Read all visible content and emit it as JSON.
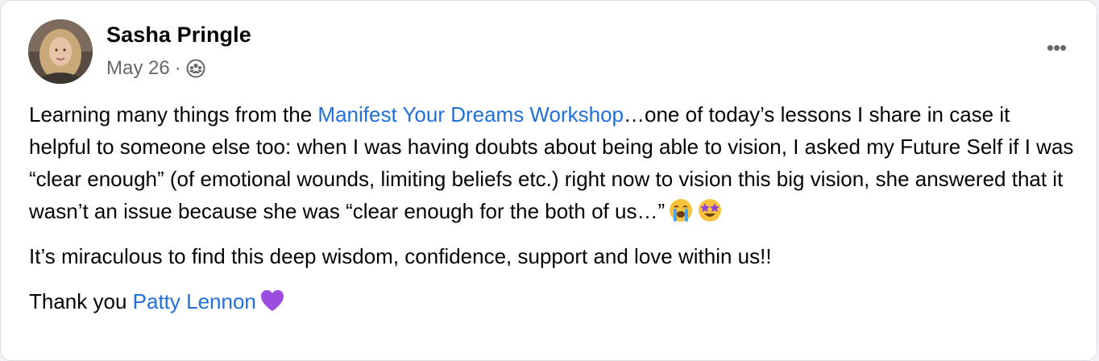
{
  "post": {
    "author": "Sasha Pringle",
    "date": "May 26",
    "separator": "·",
    "audience_icon": "friends-audience-icon",
    "more_icon": "more-options-icon",
    "more_label": "•••",
    "paragraph1": {
      "before_link": "Learning many things from the ",
      "link": "Manifest Your Dreams Workshop",
      "after_link": "…one of today’s lessons I share in case it helpful to someone else too: when I was having doubts about being able to vision, I asked my Future Self if I was “clear enough” (of emotional wounds, limiting beliefs etc.) right now to vision this big vision, she answered that it wasn’t an issue because she was “clear enough for the both of us…”",
      "emojis": [
        "crying-face-emoji",
        "star-struck-emoji"
      ]
    },
    "paragraph2": "It’s miraculous to find this deep wisdom, confidence, support and love within us!!",
    "paragraph3": {
      "before_link": "Thank you ",
      "link": "Patty Lennon",
      "emojis": [
        "purple-heart-emoji"
      ]
    }
  },
  "colors": {
    "link": "#216fdb",
    "text": "#050505",
    "secondary_text": "#65676b",
    "card_background": "#ffffff"
  }
}
